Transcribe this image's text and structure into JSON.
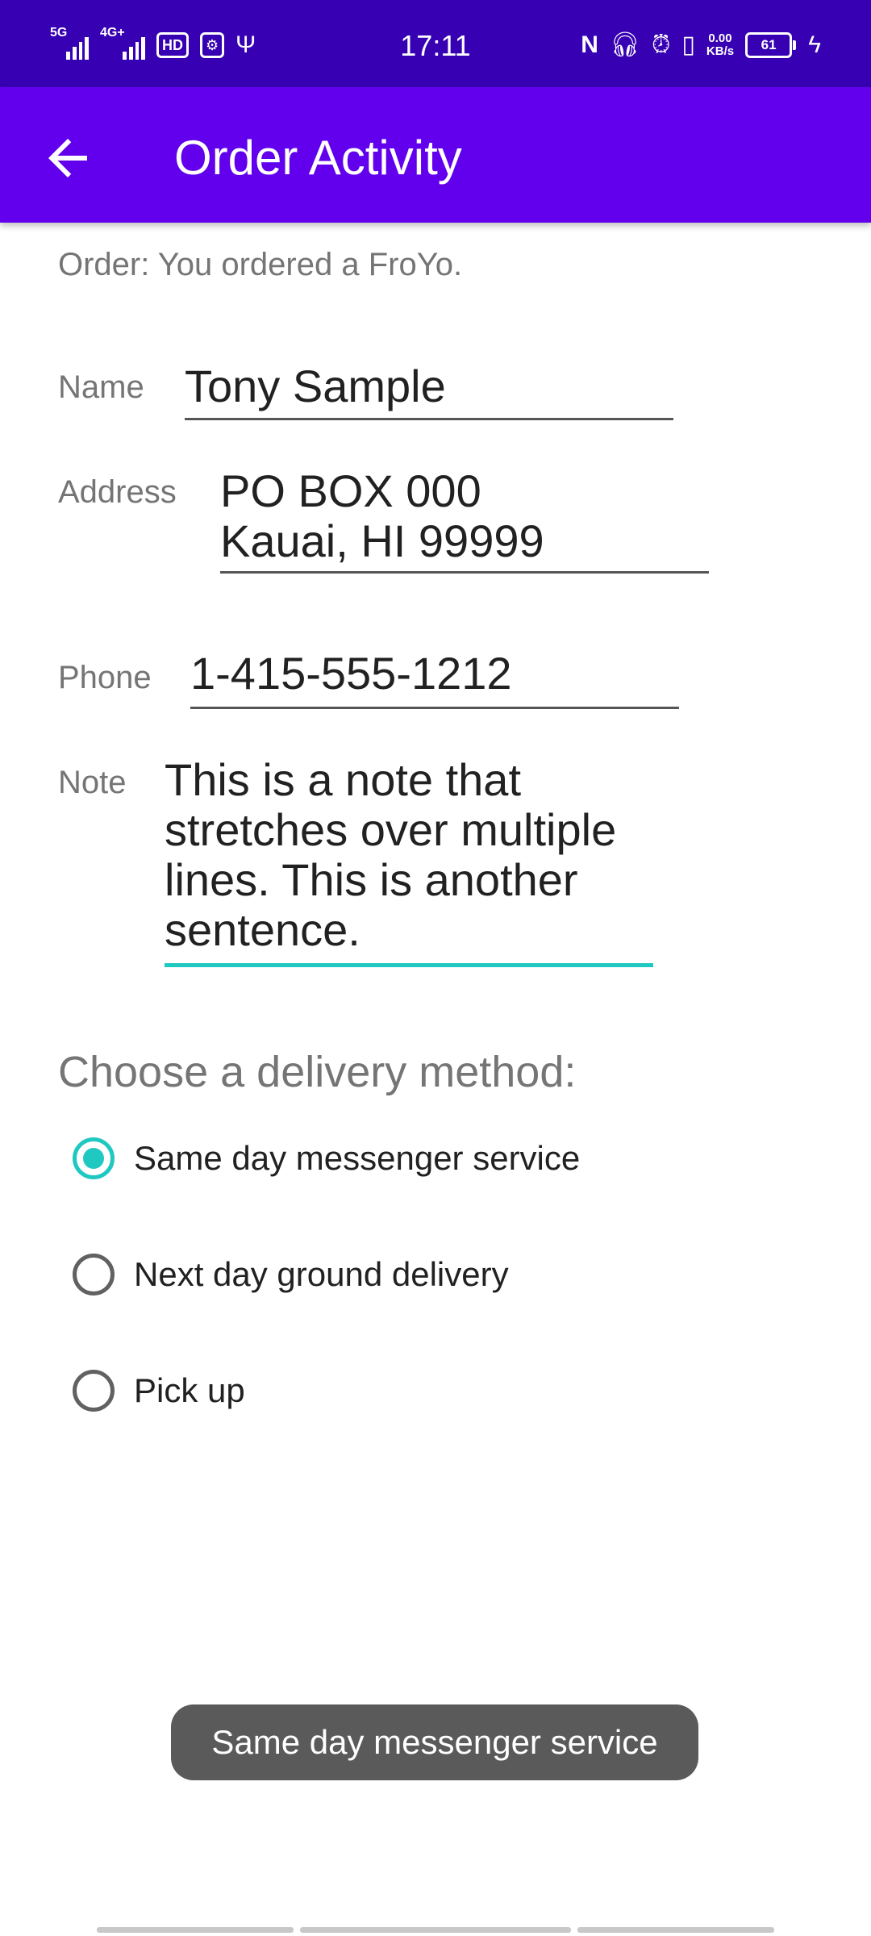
{
  "status_bar": {
    "time": "17:11",
    "net1": "5G",
    "net2": "4G+",
    "hd": "HD",
    "data_rate_value": "0.00",
    "data_rate_unit": "KB/s",
    "battery": "61",
    "icons": [
      "signal-icon",
      "hd-icon",
      "usb-icon",
      "nfc-icon",
      "headphones-icon",
      "alarm-icon",
      "vibrate-icon",
      "battery-icon",
      "charging-icon"
    ]
  },
  "app_bar": {
    "title": "Order Activity"
  },
  "order_summary": "Order: You ordered a FroYo.",
  "form": {
    "name_label": "Name",
    "name_value": "Tony Sample",
    "address_label": "Address",
    "address_line1": "PO BOX 000",
    "address_line2": "Kauai, HI 99999",
    "phone_label": "Phone",
    "phone_value": "1-415-555-1212",
    "note_label": "Note",
    "note_value": "This is a note that stretches over multiple lines. This is another sentence."
  },
  "delivery": {
    "title": "Choose a delivery method:",
    "options": [
      {
        "label": "Same day messenger service",
        "checked": true
      },
      {
        "label": "Next day ground delivery",
        "checked": false
      },
      {
        "label": "Pick up",
        "checked": false
      }
    ]
  },
  "toast": "Same day messenger service",
  "colors": {
    "status_bar": "#3700B3",
    "app_bar": "#6200EE",
    "accent": "#1FC8C0"
  }
}
